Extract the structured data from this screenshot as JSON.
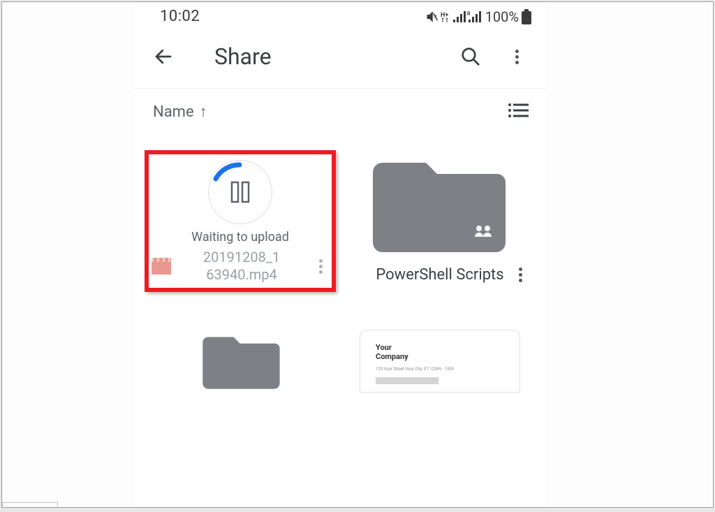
{
  "status": {
    "time": "10:02",
    "battery": "100%"
  },
  "appbar": {
    "title": "Share"
  },
  "sort": {
    "label": "Name",
    "arrow": "↑"
  },
  "items": {
    "uploading": {
      "status": "Waiting to upload",
      "filename": "20191208_163940.mp4",
      "filename_display_line1": "20191208_1",
      "filename_display_line2": "63940.mp4"
    },
    "folder1": {
      "name": "PowerShell Scripts"
    },
    "doc": {
      "line1a": "Your",
      "line1b": "Company",
      "small": "123 Your Street Your City, ST 12345 - 1905"
    }
  }
}
